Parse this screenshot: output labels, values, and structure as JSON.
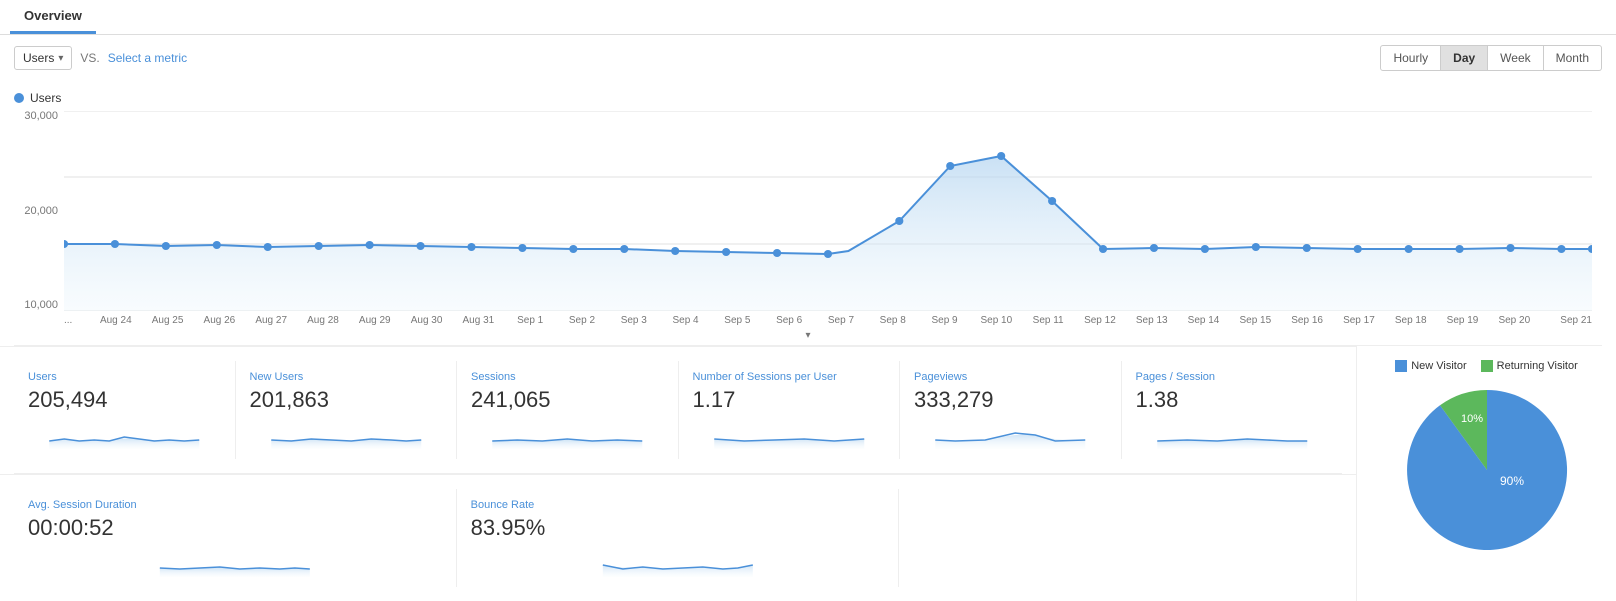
{
  "tabs": [
    {
      "label": "Overview",
      "active": true
    }
  ],
  "toolbar": {
    "metric_label": "Users",
    "vs_label": "VS.",
    "select_metric_label": "Select a metric",
    "time_buttons": [
      "Hourly",
      "Day",
      "Week",
      "Month"
    ],
    "active_time": "Day"
  },
  "chart": {
    "legend_label": "Users",
    "y_axis": [
      "30,000",
      "20,000",
      "10,000"
    ],
    "x_labels": [
      "...",
      "Aug 24",
      "Aug 25",
      "Aug 26",
      "Aug 27",
      "Aug 28",
      "Aug 29",
      "Aug 30",
      "Aug 31",
      "Sep 1",
      "Sep 2",
      "Sep 3",
      "Sep 4",
      "Sep 5",
      "Sep 6",
      "Sep 7",
      "Sep 8",
      "Sep 9",
      "Sep 10",
      "Sep 11",
      "Sep 12",
      "Sep 13",
      "Sep 14",
      "Sep 15",
      "Sep 16",
      "Sep 17",
      "Sep 18",
      "Sep 19",
      "Sep 20",
      "Sep 21"
    ]
  },
  "metrics": [
    {
      "title": "Users",
      "value": "205,494"
    },
    {
      "title": "New Users",
      "value": "201,863"
    },
    {
      "title": "Sessions",
      "value": "241,065"
    },
    {
      "title": "Number of Sessions per User",
      "value": "1.17"
    },
    {
      "title": "Pageviews",
      "value": "333,279"
    },
    {
      "title": "Pages / Session",
      "value": "1.38"
    }
  ],
  "metrics2": [
    {
      "title": "Avg. Session Duration",
      "value": "00:00:52"
    },
    {
      "title": "Bounce Rate",
      "value": "83.95%"
    }
  ],
  "pie_chart": {
    "new_visitor_pct": 90,
    "returning_visitor_pct": 10,
    "new_visitor_label": "New Visitor",
    "returning_visitor_label": "Returning Visitor",
    "new_visitor_color": "#4a90d9",
    "returning_visitor_color": "#5cb85c",
    "label_90": "90%",
    "label_10": "10%"
  }
}
